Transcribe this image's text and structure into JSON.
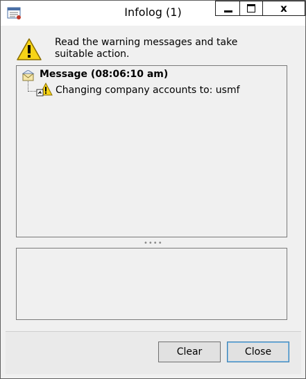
{
  "window": {
    "title": "Infolog (1)",
    "controls": {
      "minimize_icon": "minimize-icon",
      "maximize_icon": "maximize-icon",
      "close_label": "x"
    }
  },
  "header": {
    "warning_text": "Read the warning messages and take suitable action.",
    "icon": "warning-icon"
  },
  "tree": {
    "message_label": "Message (08:06:10 am)",
    "message_icon": "message-envelope-icon",
    "children": [
      {
        "label": "Changing company accounts to: usmf",
        "icon": "warning-small-icon"
      }
    ]
  },
  "splitter": {
    "grip": "••••"
  },
  "buttons": {
    "clear_label": "Clear",
    "close_label": "Close"
  },
  "colors": {
    "warning_yellow": "#f7d417",
    "window_bg": "#f0f0f0",
    "focus_border": "#3c7fb1"
  }
}
